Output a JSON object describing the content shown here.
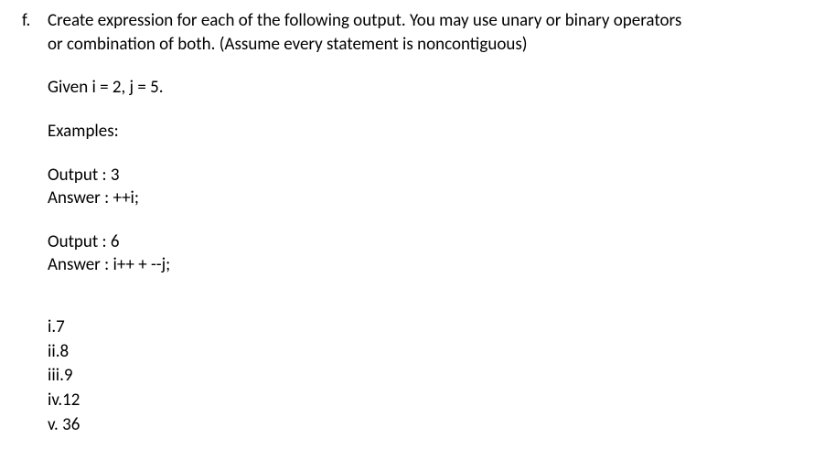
{
  "question": {
    "letter": "f.",
    "prompt_line1": "Create expression for each of the following output. You may use unary or binary operators",
    "prompt_line2": "or combination of both. (Assume every statement is noncontiguous)",
    "given": "Given i = 2, j = 5.",
    "examples_label": "Examples:",
    "examples": [
      {
        "output": "Output : 3",
        "answer": "Answer : ++i;"
      },
      {
        "output": "Output : 6",
        "answer": "Answer : i++ + --j;"
      }
    ],
    "subitems": [
      {
        "label": "i.7"
      },
      {
        "label": "ii.8"
      },
      {
        "label": "iii.9"
      },
      {
        "label": "iv.12"
      },
      {
        "label": "v. 36"
      }
    ]
  }
}
